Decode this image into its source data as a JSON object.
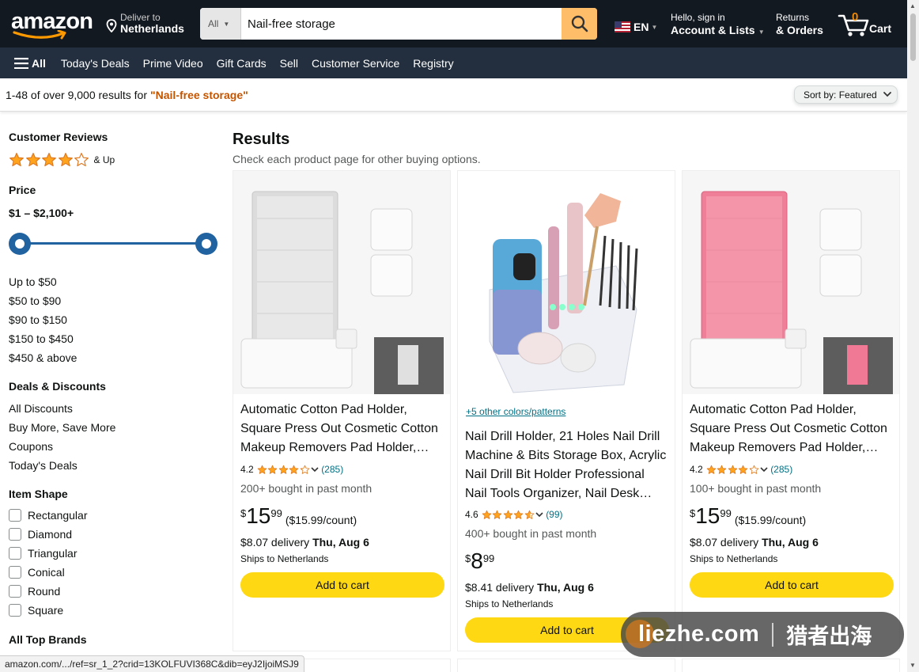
{
  "header": {
    "logo_text": "amazon",
    "deliver_line1": "Deliver to",
    "deliver_line2": "Netherlands",
    "search_category": "All",
    "search_value": "Nail-free storage",
    "language": "EN",
    "account_line1": "Hello, sign in",
    "account_line2": "Account & Lists",
    "orders_line1": "Returns",
    "orders_line2": "& Orders",
    "cart_count": "0",
    "cart_label": "Cart"
  },
  "subnav": {
    "all_label": "All",
    "items": [
      "Today's Deals",
      "Prime Video",
      "Gift Cards",
      "Sell",
      "Customer Service",
      "Registry"
    ]
  },
  "results_bar": {
    "count_text": "1-48 of over 9,000 results for",
    "query": "\"Nail-free storage\"",
    "sort_label": "Sort by:",
    "sort_value": "Featured"
  },
  "sidebar": {
    "reviews_heading": "Customer Reviews",
    "reviews_stars": 4,
    "reviews_suffix": "& Up",
    "price_heading": "Price",
    "price_range": "$1 – $2,100+",
    "price_links": [
      "Up to $50",
      "$50 to $90",
      "$90 to $150",
      "$150 to $450",
      "$450 & above"
    ],
    "deals_heading": "Deals & Discounts",
    "deals_links": [
      "All Discounts",
      "Buy More, Save More",
      "Coupons",
      "Today's Deals"
    ],
    "shape_heading": "Item Shape",
    "shapes": [
      "Rectangular",
      "Diamond",
      "Triangular",
      "Conical",
      "Round",
      "Square"
    ],
    "brands_heading": "All Top Brands"
  },
  "results": {
    "title": "Results",
    "subtitle": "Check each product page for other buying options."
  },
  "products": [
    {
      "variant": "",
      "title": "Automatic Cotton Pad Holder, Square Press Out Cosmetic Cotton Makeup Removers Pad Holder,…",
      "rating": "4.2",
      "stars": 4.2,
      "reviews": "(285)",
      "bought": "200+ bought in past month",
      "price_symbol": "$",
      "price_whole": "15",
      "price_fraction": "99",
      "price_per": "($15.99/count)",
      "delivery_prefix": "$8.07 delivery",
      "delivery_date": "Thu, Aug 6",
      "ships": "Ships to Netherlands",
      "cart_button": "Add to cart",
      "color": "#e4e4e4"
    },
    {
      "variant": "+5 other colors/patterns",
      "title": "Nail Drill Holder, 21 Holes Nail Drill Machine & Bits Storage Box, Acrylic Nail Drill Bit Holder Professional Nail Tools Organizer, Nail Desk…",
      "rating": "4.6",
      "stars": 4.6,
      "reviews": "(99)",
      "bought": "400+ bought in past month",
      "price_symbol": "$",
      "price_whole": "8",
      "price_fraction": "99",
      "price_per": "",
      "delivery_prefix": "$8.41 delivery",
      "delivery_date": "Thu, Aug 6",
      "ships": "Ships to Netherlands",
      "cart_button": "Add to cart",
      "color": "#f4f4f4"
    },
    {
      "variant": "",
      "title": "Automatic Cotton Pad Holder, Square Press Out Cosmetic Cotton Makeup Removers Pad Holder,…",
      "rating": "4.2",
      "stars": 4.2,
      "reviews": "(285)",
      "bought": "100+ bought in past month",
      "price_symbol": "$",
      "price_whole": "15",
      "price_fraction": "99",
      "price_per": "($15.99/count)",
      "delivery_prefix": "$8.07 delivery",
      "delivery_date": "Thu, Aug 6",
      "ships": "Ships to Netherlands",
      "cart_button": "Add to cart",
      "color": "#f07a95"
    }
  ],
  "status_url": "amazon.com/.../ref=sr_1_2?crid=13KOLFUVI368C&dib=eyJ2IjoiMSJ9",
  "watermark": {
    "left": "liezhe.com",
    "right": "猎者出海"
  },
  "colors": {
    "nav_bg": "#131921",
    "subnav_bg": "#232f3e",
    "search_button": "#febd69",
    "cart_button": "#ffd814",
    "star": "#ffa41c",
    "link": "#007185",
    "query": "#c45500"
  }
}
